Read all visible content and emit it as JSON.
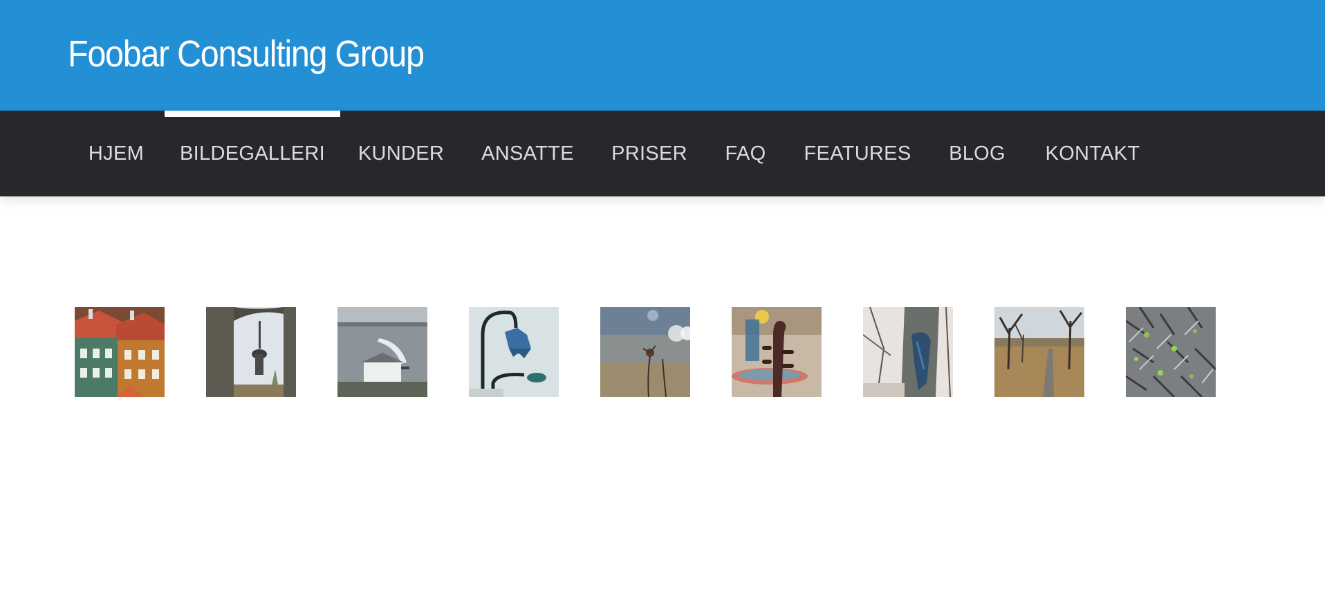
{
  "site": {
    "title": "Foobar Consulting Group"
  },
  "nav": {
    "items": [
      {
        "label": "HJEM"
      },
      {
        "label": "BILDEGALLERI",
        "active": true
      },
      {
        "label": "KUNDER"
      },
      {
        "label": "ANSATTE"
      },
      {
        "label": "PRISER"
      },
      {
        "label": "FAQ"
      },
      {
        "label": "FEATURES"
      },
      {
        "label": "BLOG"
      },
      {
        "label": "KONTAKT"
      }
    ]
  },
  "gallery": {
    "images": [
      {
        "subject": "row-houses"
      },
      {
        "subject": "tower-through-arch"
      },
      {
        "subject": "fortress-by-fjord"
      },
      {
        "subject": "bellflower-lamp"
      },
      {
        "subject": "dry-flower"
      },
      {
        "subject": "violin-scroll"
      },
      {
        "subject": "scarf-on-tree"
      },
      {
        "subject": "park-path"
      },
      {
        "subject": "sprouts"
      }
    ]
  },
  "colors": {
    "header_bg": "#238fd4",
    "nav_bg": "#27282b",
    "nav_text": "#dcdcdc",
    "active_indicator": "#ffffff"
  }
}
